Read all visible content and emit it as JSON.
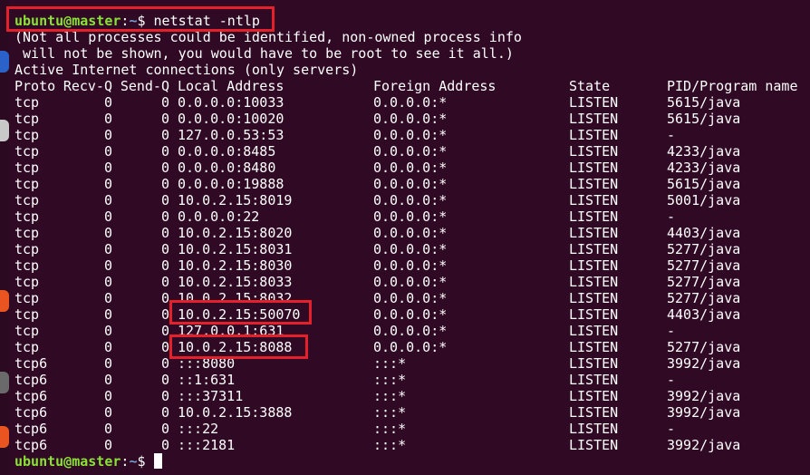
{
  "colors": {
    "background": "#300a24",
    "text": "#ffffff",
    "prompt_user": "#8ae234",
    "prompt_path": "#729fcf",
    "highlight": "#e4202a"
  },
  "prompt": {
    "user_host": "ubuntu@master",
    "separator": ":",
    "path": "~",
    "symbol": "$ "
  },
  "command": "netstat -ntlp",
  "output_messages": [
    "(Not all processes could be identified, non-owned process info",
    " will not be shown, you would have to be root to see it all.)",
    "Active Internet connections (only servers)"
  ],
  "table": {
    "headers": {
      "proto": "Proto",
      "recv": "Recv-Q",
      "send": "Send-Q",
      "local": "Local Address",
      "foreign": "Foreign Address",
      "state": "State",
      "pid": "PID/Program name"
    },
    "rows": [
      {
        "proto": "tcp",
        "recv": "0",
        "send": "0",
        "local": "0.0.0.0:10033",
        "foreign": "0.0.0.0:*",
        "state": "LISTEN",
        "pid": "5615/java"
      },
      {
        "proto": "tcp",
        "recv": "0",
        "send": "0",
        "local": "0.0.0.0:10020",
        "foreign": "0.0.0.0:*",
        "state": "LISTEN",
        "pid": "5615/java"
      },
      {
        "proto": "tcp",
        "recv": "0",
        "send": "0",
        "local": "127.0.0.53:53",
        "foreign": "0.0.0.0:*",
        "state": "LISTEN",
        "pid": "-"
      },
      {
        "proto": "tcp",
        "recv": "0",
        "send": "0",
        "local": "0.0.0.0:8485",
        "foreign": "0.0.0.0:*",
        "state": "LISTEN",
        "pid": "4233/java"
      },
      {
        "proto": "tcp",
        "recv": "0",
        "send": "0",
        "local": "0.0.0.0:8480",
        "foreign": "0.0.0.0:*",
        "state": "LISTEN",
        "pid": "4233/java"
      },
      {
        "proto": "tcp",
        "recv": "0",
        "send": "0",
        "local": "0.0.0.0:19888",
        "foreign": "0.0.0.0:*",
        "state": "LISTEN",
        "pid": "5615/java"
      },
      {
        "proto": "tcp",
        "recv": "0",
        "send": "0",
        "local": "10.0.2.15:8019",
        "foreign": "0.0.0.0:*",
        "state": "LISTEN",
        "pid": "5001/java"
      },
      {
        "proto": "tcp",
        "recv": "0",
        "send": "0",
        "local": "0.0.0.0:22",
        "foreign": "0.0.0.0:*",
        "state": "LISTEN",
        "pid": "-"
      },
      {
        "proto": "tcp",
        "recv": "0",
        "send": "0",
        "local": "10.0.2.15:8020",
        "foreign": "0.0.0.0:*",
        "state": "LISTEN",
        "pid": "4403/java"
      },
      {
        "proto": "tcp",
        "recv": "0",
        "send": "0",
        "local": "10.0.2.15:8031",
        "foreign": "0.0.0.0:*",
        "state": "LISTEN",
        "pid": "5277/java"
      },
      {
        "proto": "tcp",
        "recv": "0",
        "send": "0",
        "local": "10.0.2.15:8030",
        "foreign": "0.0.0.0:*",
        "state": "LISTEN",
        "pid": "5277/java"
      },
      {
        "proto": "tcp",
        "recv": "0",
        "send": "0",
        "local": "10.0.2.15:8033",
        "foreign": "0.0.0.0:*",
        "state": "LISTEN",
        "pid": "5277/java"
      },
      {
        "proto": "tcp",
        "recv": "0",
        "send": "0",
        "local": "10.0.2.15:8032",
        "foreign": "0.0.0.0:*",
        "state": "LISTEN",
        "pid": "5277/java"
      },
      {
        "proto": "tcp",
        "recv": "0",
        "send": "0",
        "local": "10.0.2.15:50070",
        "foreign": "0.0.0.0:*",
        "state": "LISTEN",
        "pid": "4403/java"
      },
      {
        "proto": "tcp",
        "recv": "0",
        "send": "0",
        "local": "127.0.0.1:631",
        "foreign": "0.0.0.0:*",
        "state": "LISTEN",
        "pid": "-"
      },
      {
        "proto": "tcp",
        "recv": "0",
        "send": "0",
        "local": "10.0.2.15:8088",
        "foreign": "0.0.0.0:*",
        "state": "LISTEN",
        "pid": "5277/java"
      },
      {
        "proto": "tcp6",
        "recv": "0",
        "send": "0",
        "local": ":::8080",
        "foreign": ":::*",
        "state": "LISTEN",
        "pid": "3992/java"
      },
      {
        "proto": "tcp6",
        "recv": "0",
        "send": "0",
        "local": "::1:631",
        "foreign": ":::*",
        "state": "LISTEN",
        "pid": "-"
      },
      {
        "proto": "tcp6",
        "recv": "0",
        "send": "0",
        "local": ":::37311",
        "foreign": ":::*",
        "state": "LISTEN",
        "pid": "3992/java"
      },
      {
        "proto": "tcp6",
        "recv": "0",
        "send": "0",
        "local": "10.0.2.15:3888",
        "foreign": ":::*",
        "state": "LISTEN",
        "pid": "3992/java"
      },
      {
        "proto": "tcp6",
        "recv": "0",
        "send": "0",
        "local": ":::22",
        "foreign": ":::*",
        "state": "LISTEN",
        "pid": "-"
      },
      {
        "proto": "tcp6",
        "recv": "0",
        "send": "0",
        "local": ":::2181",
        "foreign": ":::*",
        "state": "LISTEN",
        "pid": "3992/java"
      }
    ]
  }
}
